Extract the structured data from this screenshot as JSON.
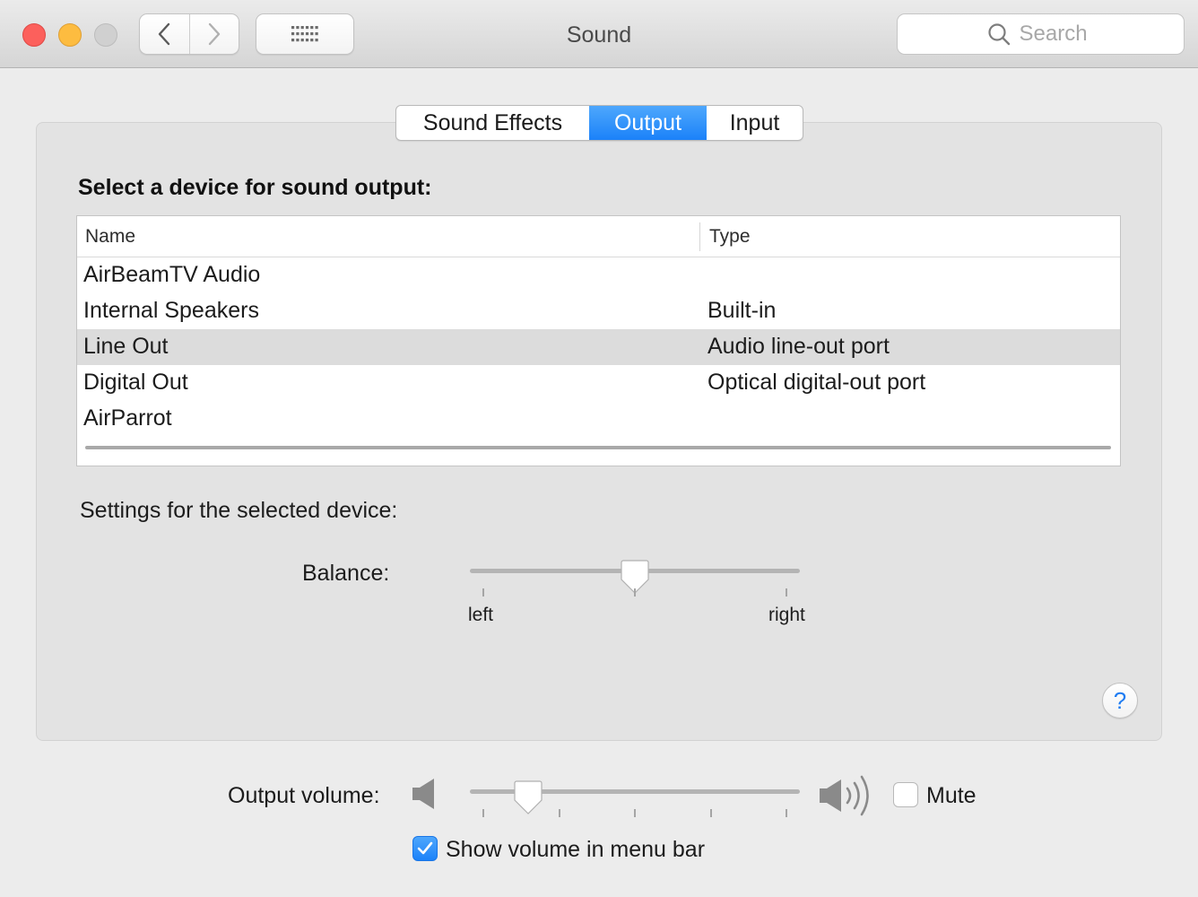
{
  "window": {
    "title": "Sound"
  },
  "search": {
    "placeholder": "Search"
  },
  "tabs": [
    {
      "label": "Sound Effects",
      "active": false
    },
    {
      "label": "Output",
      "active": true
    },
    {
      "label": "Input",
      "active": false
    }
  ],
  "output": {
    "section_title": "Select a device for sound output:",
    "columns": {
      "name": "Name",
      "type": "Type"
    },
    "devices": [
      {
        "name": "AirBeamTV Audio",
        "type": ""
      },
      {
        "name": "Internal Speakers",
        "type": "Built-in"
      },
      {
        "name": "Line Out",
        "type": "Audio line-out port",
        "selected": true
      },
      {
        "name": "Digital Out",
        "type": "Optical digital-out port"
      },
      {
        "name": "AirParrot",
        "type": ""
      }
    ]
  },
  "settings": {
    "label": "Settings for the selected device:",
    "balance": {
      "label": "Balance:",
      "left_label": "left",
      "right_label": "right",
      "value": 0.5
    }
  },
  "volume": {
    "label": "Output volume:",
    "level": 0.15,
    "mute_label": "Mute",
    "muted": false,
    "show_in_menubar_label": "Show volume in menu bar",
    "show_in_menubar": true
  },
  "colors": {
    "accent": "#1b82f9",
    "selection_row": "#dcdcdc",
    "help": "#1f7cf2"
  },
  "icons": {
    "back": "chevron-left-icon",
    "forward": "chevron-right-icon",
    "show_all": "grid-icon",
    "search": "magnifier-icon",
    "help": "question-mark-icon",
    "volume_low": "speaker-low-icon",
    "volume_high": "speaker-high-icon",
    "check": "checkmark-icon"
  }
}
